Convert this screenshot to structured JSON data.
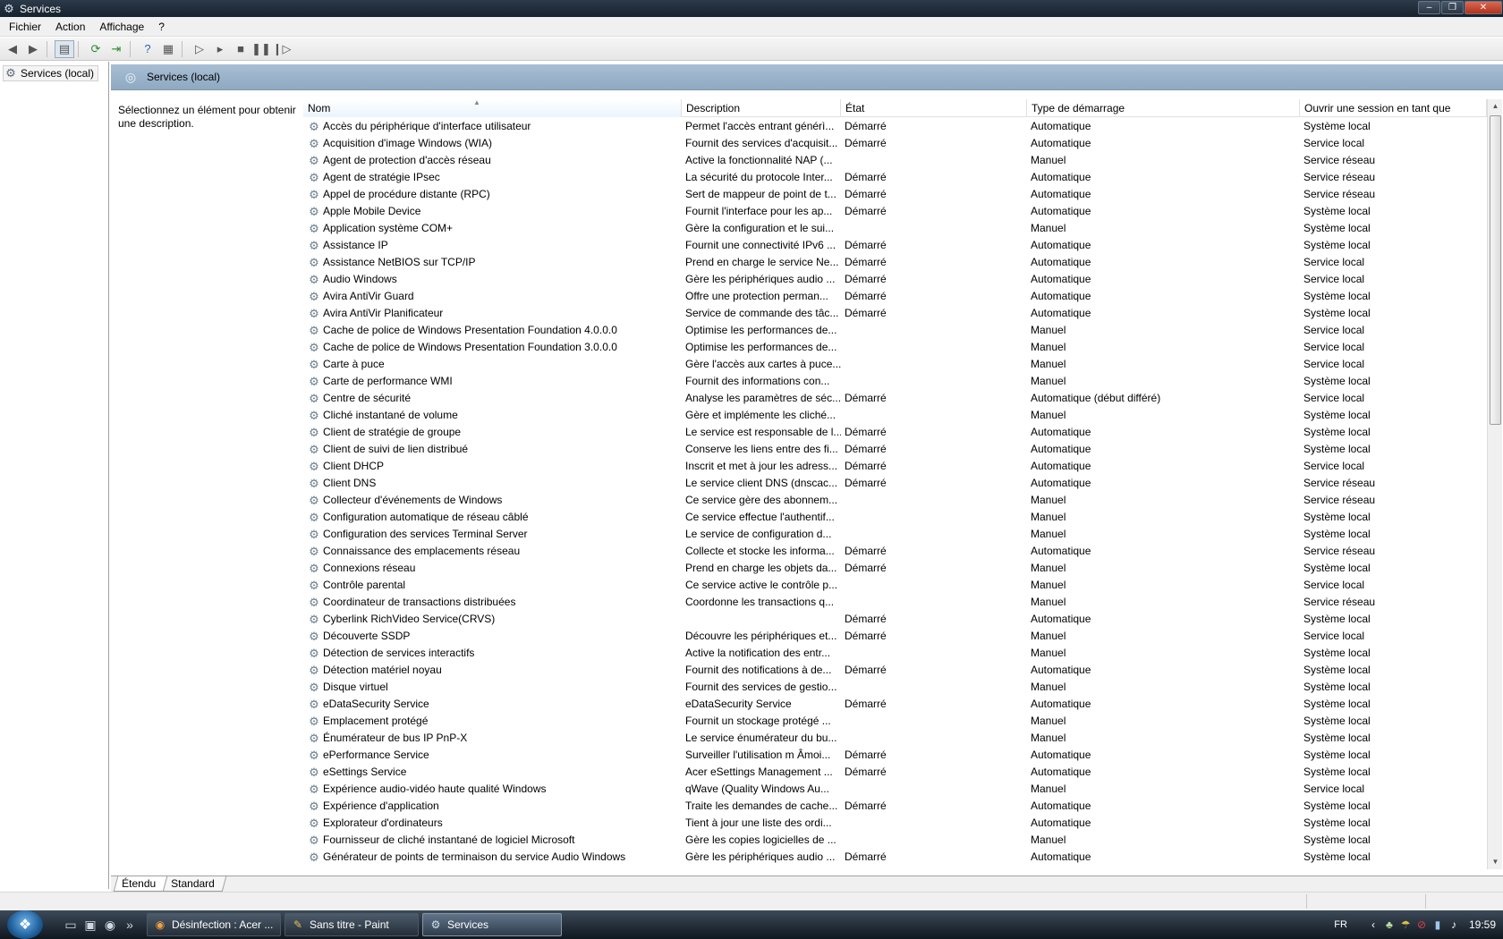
{
  "window": {
    "title": "Services"
  },
  "menu": [
    "Fichier",
    "Action",
    "Affichage",
    "?"
  ],
  "tree": {
    "root": "Services (local)"
  },
  "pane": {
    "header": "Services (local)",
    "description": "Sélectionnez un élément pour obtenir une description."
  },
  "table": {
    "headers": [
      "Nom",
      "Description",
      "État",
      "Type de démarrage",
      "Ouvrir une session en tant que"
    ],
    "rows": [
      [
        "Accès du périphérique d'interface utilisateur",
        "Permet l'accès entrant générì...",
        "Démarré",
        "Automatique",
        "Système local"
      ],
      [
        "Acquisition d'image Windows (WIA)",
        "Fournit des services d'acquisit...",
        "Démarré",
        "Automatique",
        "Service local"
      ],
      [
        "Agent de protection d'accès réseau",
        "Active la fonctionnalité NAP (...",
        "",
        "Manuel",
        "Service réseau"
      ],
      [
        "Agent de stratégie IPsec",
        "La sécurité du protocole Inter...",
        "Démarré",
        "Automatique",
        "Service réseau"
      ],
      [
        "Appel de procédure distante (RPC)",
        "Sert de mappeur de point de t...",
        "Démarré",
        "Automatique",
        "Service réseau"
      ],
      [
        "Apple Mobile Device",
        "Fournit l'interface pour les ap...",
        "Démarré",
        "Automatique",
        "Système local"
      ],
      [
        "Application système COM+",
        "Gère la configuration et le sui...",
        "",
        "Manuel",
        "Système local"
      ],
      [
        "Assistance IP",
        "Fournit une connectivité IPv6 ...",
        "Démarré",
        "Automatique",
        "Système local"
      ],
      [
        "Assistance NetBIOS sur TCP/IP",
        "Prend en charge le service Ne...",
        "Démarré",
        "Automatique",
        "Service local"
      ],
      [
        "Audio Windows",
        "Gère les périphériques audio ...",
        "Démarré",
        "Automatique",
        "Service local"
      ],
      [
        "Avira AntiVir Guard",
        "Offre une protection perman...",
        "Démarré",
        "Automatique",
        "Système local"
      ],
      [
        "Avira AntiVir Planificateur",
        "Service de commande des tâc...",
        "Démarré",
        "Automatique",
        "Système local"
      ],
      [
        "Cache de police de Windows Presentation Foundation 4.0.0.0",
        "Optimise les performances de...",
        "",
        "Manuel",
        "Service local"
      ],
      [
        "Cache de police de Windows Presentation Foundation 3.0.0.0",
        "Optimise les performances de...",
        "",
        "Manuel",
        "Service local"
      ],
      [
        "Carte à puce",
        "Gère l'accès aux cartes à puce...",
        "",
        "Manuel",
        "Service local"
      ],
      [
        "Carte de performance WMI",
        "Fournit des informations con...",
        "",
        "Manuel",
        "Système local"
      ],
      [
        "Centre de sécurité",
        "Analyse les paramètres de séc...",
        "Démarré",
        "Automatique (début différé)",
        "Service local"
      ],
      [
        "Cliché instantané de volume",
        "Gère et implémente les cliché...",
        "",
        "Manuel",
        "Système local"
      ],
      [
        "Client de stratégie de groupe",
        "Le service est responsable de l...",
        "Démarré",
        "Automatique",
        "Système local"
      ],
      [
        "Client de suivi de lien distribué",
        "Conserve les liens entre des fi...",
        "Démarré",
        "Automatique",
        "Système local"
      ],
      [
        "Client DHCP",
        "Inscrit et met à jour les adress...",
        "Démarré",
        "Automatique",
        "Service local"
      ],
      [
        "Client DNS",
        "Le service client DNS (dnscac...",
        "Démarré",
        "Automatique",
        "Service réseau"
      ],
      [
        "Collecteur d'événements de Windows",
        "Ce service gère des abonnem...",
        "",
        "Manuel",
        "Service réseau"
      ],
      [
        "Configuration automatique de réseau câblé",
        "Ce service effectue l'authentif...",
        "",
        "Manuel",
        "Système local"
      ],
      [
        "Configuration des services Terminal Server",
        "Le service de configuration d...",
        "",
        "Manuel",
        "Système local"
      ],
      [
        "Connaissance des emplacements réseau",
        "Collecte et stocke les informa...",
        "Démarré",
        "Automatique",
        "Service réseau"
      ],
      [
        "Connexions réseau",
        "Prend en charge les objets da...",
        "Démarré",
        "Manuel",
        "Système local"
      ],
      [
        "Contrôle parental",
        "Ce service active le contrôle p...",
        "",
        "Manuel",
        "Service local"
      ],
      [
        "Coordinateur de transactions distribuées",
        "Coordonne les transactions q...",
        "",
        "Manuel",
        "Service réseau"
      ],
      [
        "Cyberlink RichVideo Service(CRVS)",
        "",
        "Démarré",
        "Automatique",
        "Système local"
      ],
      [
        "Découverte SSDP",
        "Découvre les périphériques et...",
        "Démarré",
        "Manuel",
        "Service local"
      ],
      [
        "Détection de services interactifs",
        "Active la notification des entr...",
        "",
        "Manuel",
        "Système local"
      ],
      [
        "Détection matériel noyau",
        "Fournit des notifications à de...",
        "Démarré",
        "Automatique",
        "Système local"
      ],
      [
        "Disque virtuel",
        "Fournit des services de gestio...",
        "",
        "Manuel",
        "Système local"
      ],
      [
        "eDataSecurity Service",
        "eDataSecurity Service",
        "Démarré",
        "Automatique",
        "Système local"
      ],
      [
        "Emplacement protégé",
        "Fournit un stockage protégé ...",
        "",
        "Manuel",
        "Système local"
      ],
      [
        "Énumérateur de bus IP PnP-X",
        "Le service énumérateur du bu...",
        "",
        "Manuel",
        "Système local"
      ],
      [
        "ePerformance Service",
        "Surveiller l'utilisation m Âmoi...",
        "Démarré",
        "Automatique",
        "Système local"
      ],
      [
        "eSettings Service",
        "Acer eSettings Management ...",
        "Démarré",
        "Automatique",
        "Système local"
      ],
      [
        "Expérience audio-vidéo haute qualité Windows",
        "qWave (Quality Windows Au...",
        "",
        "Manuel",
        "Service local"
      ],
      [
        "Expérience d'application",
        "Traite les demandes de cache...",
        "Démarré",
        "Automatique",
        "Système local"
      ],
      [
        "Explorateur d'ordinateurs",
        "Tient à jour une liste des ordi...",
        "",
        "Automatique",
        "Système local"
      ],
      [
        "Fournisseur de cliché instantané de logiciel Microsoft",
        "Gère les copies logicielles de ...",
        "",
        "Manuel",
        "Système local"
      ],
      [
        "Générateur de points de terminaison du service Audio Windows",
        "Gère les périphériques audio ...",
        "Démarré",
        "Automatique",
        "Système local"
      ]
    ]
  },
  "bottom_tabs": [
    "Étendu",
    "Standard"
  ],
  "taskbar": {
    "tasks": [
      {
        "label": "Désinfection : Acer ...",
        "icon": "firefox-icon"
      },
      {
        "label": "Sans titre - Paint",
        "icon": "paint-icon"
      },
      {
        "label": "Services",
        "icon": "services-gear-icon"
      }
    ],
    "language": "FR",
    "clock": "19:59"
  }
}
